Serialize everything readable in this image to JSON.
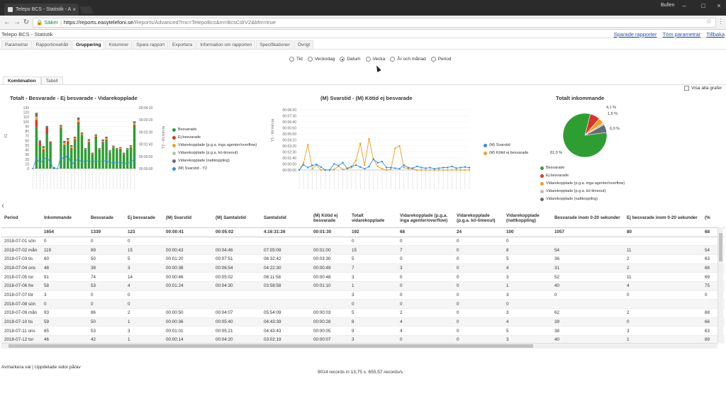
{
  "browser": {
    "tab_title": "Telepo BCS - Statistik - A",
    "window_user": "Bullen",
    "secure_label": "Säker",
    "url_host": "https://reports.easytelefoni.se",
    "url_path": "/Reports/Advanced?mc=TelepoBcs&m=BcsCdrV2&bfm=true"
  },
  "app": {
    "title": "Telepo BCS - Statistik",
    "header_links": [
      "Sparade rapporter",
      "Töm parametrar",
      "Tillbaka"
    ],
    "tabs": [
      "Parametrar",
      "Rapportinnehåll",
      "Gruppering",
      "Kolumner",
      "Spara rapport",
      "Exportera",
      "Information om rapporten",
      "Specifikationer",
      "Övrigt"
    ],
    "active_tab": "Gruppering",
    "grouping_options": [
      "Tid",
      "Veckodag",
      "Datum",
      "Vecka",
      "År och månad",
      "Period"
    ],
    "selected_grouping": "Datum",
    "subtabs": [
      "Kombination",
      "Tabell"
    ],
    "show_all_label": "Visa alla grafer"
  },
  "chart_data": [
    {
      "type": "bar",
      "title": "Totalt - Besvarade - Ej besvarade - Vidarekopplade",
      "ylabel": "Y1",
      "y2label": "Y2 - hh:mm:ss",
      "ylim": [
        0,
        130
      ],
      "yticks": [
        "130",
        "120",
        "110",
        "100",
        "90",
        "80",
        "70",
        "60",
        "50",
        "40",
        "30",
        "20",
        "10",
        "0"
      ],
      "y2ticks": [
        "00:04:10",
        "00:03:20",
        "00:02:30",
        "00:01:40",
        "00:00:50",
        "00:00:00"
      ],
      "series": [
        {
          "name": "Besvarade",
          "values": [
            0,
            89,
            50,
            38,
            74,
            53,
            0,
            0,
            86,
            50,
            53,
            42,
            60,
            95,
            70,
            40,
            55,
            30,
            65,
            40,
            55,
            60,
            35,
            45,
            40,
            40,
            30,
            40,
            45,
            90
          ]
        },
        {
          "name": "Ej besvarade",
          "values": [
            0,
            15,
            5,
            3,
            14,
            4,
            0,
            0,
            2,
            1,
            5,
            2,
            3,
            4,
            2,
            1,
            2,
            1,
            3,
            1,
            2,
            2,
            1,
            1,
            1,
            2,
            1,
            1,
            1,
            3
          ]
        },
        {
          "name": "Vidarekopplade (p.g.a. inga agenter/overflow)",
          "values": [
            0,
            7,
            0,
            3,
            0,
            0,
            0,
            0,
            2,
            4,
            4,
            3,
            2,
            5,
            2,
            1,
            3,
            1,
            2,
            1,
            2,
            3,
            1,
            1,
            1,
            2,
            1,
            1,
            2,
            4
          ]
        },
        {
          "name": "Vidarekopplade (p.g.a. kö-timeout)",
          "values": [
            0,
            0,
            0,
            0,
            0,
            0,
            0,
            0,
            0,
            0,
            0,
            0,
            0,
            0,
            0,
            0,
            0,
            0,
            0,
            0,
            0,
            0,
            0,
            0,
            0,
            0,
            0,
            0,
            0,
            0
          ]
        },
        {
          "name": "Vidarekopplade (nattkoppling)",
          "values": [
            0,
            8,
            5,
            4,
            3,
            1,
            3,
            0,
            3,
            4,
            3,
            3,
            3,
            5,
            3,
            2,
            3,
            2,
            3,
            2,
            3,
            3,
            2,
            2,
            2,
            2,
            2,
            2,
            2,
            4
          ]
        },
        {
          "name": "(M) Svarstid - Y2",
          "values": [
            0,
            43,
            20,
            38,
            46,
            24,
            0,
            0,
            50,
            36,
            61,
            14,
            30,
            40,
            25,
            35,
            28,
            30,
            32,
            28,
            30,
            34,
            22,
            26,
            24,
            28,
            20,
            24,
            26,
            40
          ]
        }
      ]
    },
    {
      "type": "line",
      "title": "(M) Svarstid - (M) Kötid ej besvarade",
      "ylabel": "Y1 - hh:mm:ss",
      "yticks": [
        "00:08:20",
        "00:07:30",
        "00:06:40",
        "00:05:50",
        "00:05:00",
        "00:04:10",
        "00:03:20",
        "00:02:30",
        "00:01:40",
        "00:00:50",
        "00:00:00"
      ],
      "ylim": [
        0,
        500
      ],
      "series": [
        {
          "name": "(M) Svarstid",
          "values": [
            0,
            43,
            20,
            38,
            46,
            24,
            0,
            0,
            50,
            36,
            61,
            14,
            30,
            40,
            25,
            10,
            28,
            90,
            60,
            70,
            20,
            20,
            15,
            10,
            40,
            20,
            15,
            30,
            20,
            15,
            20,
            10,
            15,
            20,
            20,
            30,
            15,
            20,
            25,
            20
          ]
        },
        {
          "name": "(M) Kötid ej besvarade",
          "values": [
            0,
            60,
            210,
            10,
            40,
            0,
            0,
            0,
            5,
            30,
            5,
            10,
            20,
            80,
            220,
            40,
            260,
            90,
            30,
            10,
            0,
            5,
            180,
            200,
            20,
            10,
            10,
            0,
            0,
            0,
            0,
            0,
            0,
            0,
            0,
            0,
            0,
            0,
            0,
            0
          ]
        }
      ]
    },
    {
      "type": "pie",
      "title": "Totalt inkommande",
      "slices": [
        {
          "name": "Besvarade",
          "value": 81.0,
          "label": "81,0 %"
        },
        {
          "name": "Ej besvarade",
          "value": 7.4,
          "label": ""
        },
        {
          "name": "Vidarekopplade (p.g.a. inga agenter/overflow)",
          "value": 4.1,
          "label": "4,1 %"
        },
        {
          "name": "Vidarekopplade (p.g.a. kö-timeout)",
          "value": 1.5,
          "label": "1,5 %"
        },
        {
          "name": "Vidarekopplade (nattkoppling)",
          "value": 6.0,
          "label": "6,0 %"
        }
      ]
    }
  ],
  "colors": {
    "green": "#2e9e33",
    "red": "#d9342b",
    "orange": "#f0a020",
    "lightgrey": "#bdbdbd",
    "darkgrey": "#666c75",
    "blue": "#2d8fe0"
  },
  "table": {
    "headers": [
      "Period",
      "Inkommande",
      "Besvarade",
      "Ej besvarade",
      "(M) Svarstid",
      "(M) Samtalstid",
      "Samtalstid",
      "(M) Kötid ej besvarade",
      "Totalt vidarekopplade",
      "Vidarekopplade (p.g.a. inga agenter/overflow)",
      "Vidarekopplade (p.g.a. kö-timeout)",
      "Vidarekopplade (nattkoppling)",
      "Besvarade inom 0-20 sekunder",
      "Ej besvarade inom 0-20 sekunder",
      "(%"
    ],
    "totals": [
      "",
      "1654",
      "1339",
      "123",
      "00:00:41",
      "00:05:02",
      "4.16:31:26",
      "00:01:30",
      "192",
      "68",
      "24",
      "100",
      "1057",
      "80",
      "68"
    ],
    "rows": [
      [
        "2018-07-01 sön",
        "0",
        "0",
        "0",
        "",
        "",
        "",
        "",
        "0",
        "0",
        "0",
        "0",
        "",
        "",
        ""
      ],
      [
        "2018-07-02 mån",
        "119",
        "89",
        "15",
        "00:00:43",
        "00:04:46",
        "07:05:09",
        "00:01:00",
        "15",
        "7",
        "0",
        "8",
        "54",
        "11",
        "54"
      ],
      [
        "2018-07-03 tis",
        "60",
        "50",
        "5",
        "00:01:20",
        "00:07:51",
        "06:32:42",
        "00:03:30",
        "5",
        "0",
        "0",
        "5",
        "36",
        "2",
        "63"
      ],
      [
        "2018-07-04 ons",
        "48",
        "38",
        "3",
        "00:00:38",
        "00:06:54",
        "04:22:30",
        "00:00:49",
        "7",
        "3",
        "0",
        "4",
        "31",
        "2",
        "68"
      ],
      [
        "2018-07-05 tor",
        "91",
        "74",
        "14",
        "00:00:46",
        "00:05:02",
        "06:11:58",
        "00:00:48",
        "3",
        "0",
        "0",
        "3",
        "52",
        "11",
        "69"
      ],
      [
        "2018-07-06 fre",
        "58",
        "53",
        "4",
        "00:01:24",
        "00:04:30",
        "03:58:58",
        "00:01:10",
        "1",
        "0",
        "0",
        "1",
        "40",
        "4",
        "75"
      ],
      [
        "2018-07-07 lör",
        "3",
        "0",
        "0",
        "",
        "",
        "",
        "",
        "3",
        "0",
        "0",
        "3",
        "0",
        "0",
        "0"
      ],
      [
        "2018-07-08 sön",
        "0",
        "0",
        "0",
        "",
        "",
        "",
        "",
        "0",
        "0",
        "0",
        "0",
        "",
        "",
        ""
      ],
      [
        "2018-07-09 mån",
        "93",
        "86",
        "2",
        "00:00:50",
        "00:04:07",
        "05:54:09",
        "00:00:03",
        "5",
        "2",
        "0",
        "3",
        "62",
        "2",
        "68"
      ],
      [
        "2018-07-10 tis",
        "59",
        "50",
        "1",
        "00:00:36",
        "00:05:40",
        "04:43:39",
        "00:00:28",
        "8",
        "4",
        "0",
        "4",
        "39",
        "0",
        "66"
      ],
      [
        "2018-07-11 ons",
        "65",
        "53",
        "3",
        "00:01:01",
        "00:05:21",
        "04:43:43",
        "00:00:05",
        "9",
        "4",
        "0",
        "5",
        "38",
        "3",
        "63"
      ],
      [
        "2018-07-12 tor",
        "46",
        "42",
        "1",
        "00:00:14",
        "00:04:20",
        "03:02:19",
        "00:00:07",
        "3",
        "0",
        "0",
        "3",
        "40",
        "1",
        "89"
      ]
    ]
  },
  "footer": {
    "left_text": "Avmarkera val | Uppdelade sidor på/av",
    "records_text": "9014 records in 13,75 s. 655,57 records/s"
  }
}
